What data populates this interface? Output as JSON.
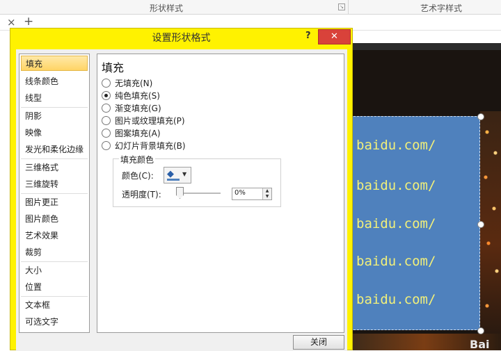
{
  "ribbon": {
    "group1": "形状样式",
    "group2": "艺术字样式"
  },
  "tabs": {
    "close": "×",
    "add": "+"
  },
  "dialog": {
    "title": "设置形状格式",
    "help": "?",
    "close": "✕",
    "nav": [
      "填充",
      "线条颜色",
      "线型",
      "阴影",
      "映像",
      "发光和柔化边缘",
      "三维格式",
      "三维旋转",
      "图片更正",
      "图片颜色",
      "艺术效果",
      "裁剪",
      "大小",
      "位置",
      "文本框",
      "可选文字"
    ],
    "selected_nav": "填充",
    "panel_title": "填充",
    "fill_options": [
      {
        "label": "无填充(N)",
        "checked": false
      },
      {
        "label": "纯色填充(S)",
        "checked": true
      },
      {
        "label": "渐变填充(G)",
        "checked": false
      },
      {
        "label": "图片或纹理填充(P)",
        "checked": false
      },
      {
        "label": "图案填充(A)",
        "checked": false
      },
      {
        "label": "幻灯片背景填充(B)",
        "checked": false
      }
    ],
    "fill_color_group": "填充颜色",
    "color_label": "颜色(C):",
    "transparency_label": "透明度(T):",
    "transparency_value": "0%",
    "close_button": "关闭"
  },
  "slide": {
    "text_lines": [
      "baidu.com/",
      "baidu.com/",
      "baidu.com/",
      "baidu.com/",
      "baidu.com/"
    ],
    "watermark": "Bai"
  },
  "colors": {
    "dialog_border": "#fff200",
    "shape_fill": "#4f81bd",
    "shape_text": "#f2f07a",
    "close_red": "#d9423a"
  }
}
